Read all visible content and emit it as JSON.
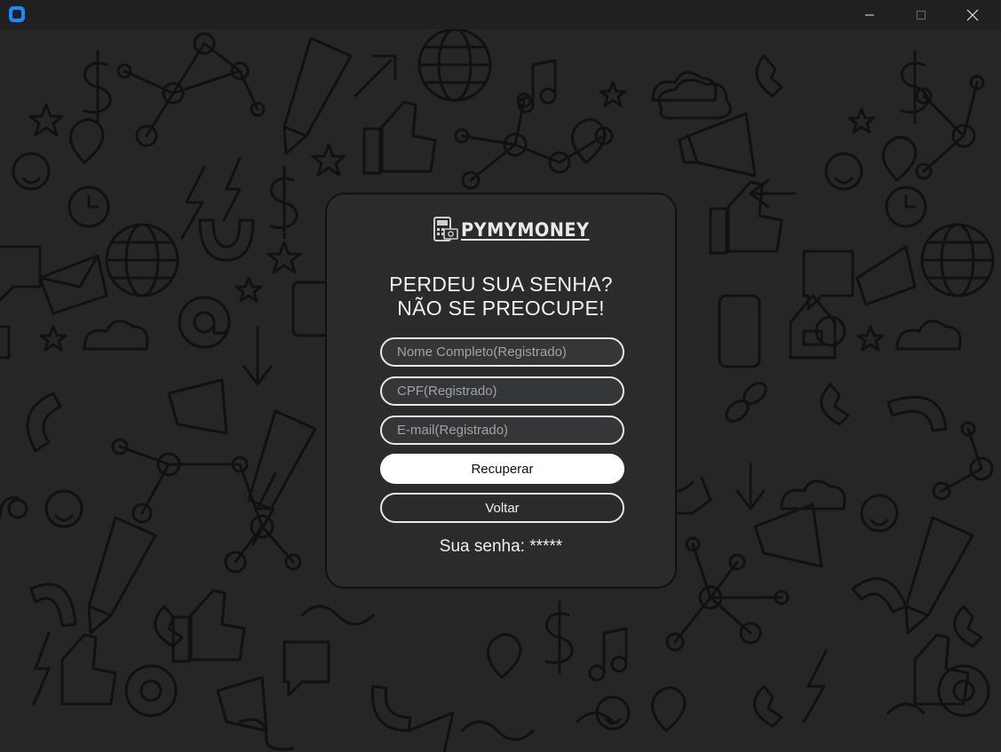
{
  "window": {
    "controls": {
      "minimize_icon": "minimize-icon",
      "maximize_icon": "maximize-icon",
      "close_icon": "close-icon"
    }
  },
  "logo": {
    "text": "PYMYMONEY",
    "icon": "money-calculator-icon"
  },
  "heading": {
    "line1": "PERDEU SUA SENHA?",
    "line2": "NÃO SE PREOCUPE!"
  },
  "form": {
    "full_name_placeholder": "Nome Completo(Registrado)",
    "cpf_placeholder": "CPF(Registrado)",
    "email_placeholder": "E-mail(Registrado)",
    "recover_label": "Recuperar",
    "back_label": "Voltar"
  },
  "result": {
    "label": "Sua senha:",
    "value": "*****"
  },
  "colors": {
    "background": "#262626",
    "card": "#2b2b2c",
    "accent": "#ffffff",
    "app_icon": "#1e88ff"
  }
}
